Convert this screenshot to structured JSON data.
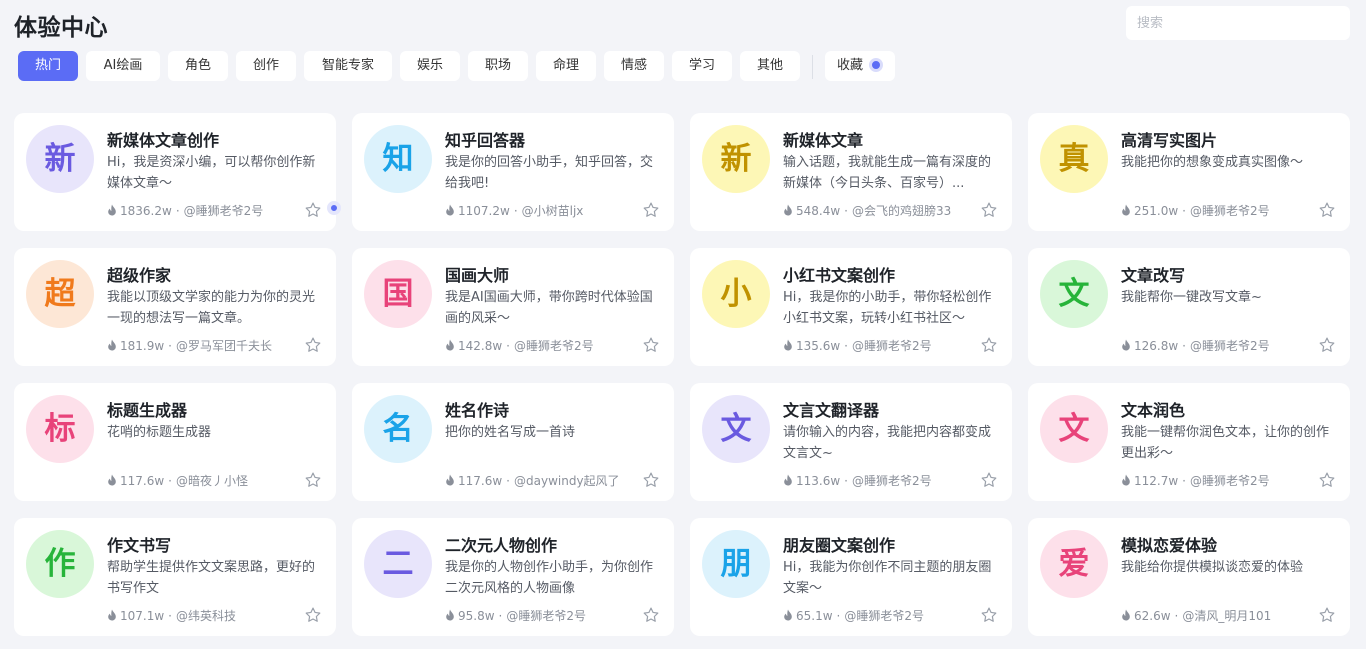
{
  "page": {
    "title": "体验中心"
  },
  "search": {
    "placeholder": "搜索"
  },
  "tabs": [
    "热门",
    "AI绘画",
    "角色",
    "创作",
    "智能专家",
    "娱乐",
    "职场",
    "命理",
    "情感",
    "学习",
    "其他"
  ],
  "favorites_label": "收藏",
  "colors": {
    "accent": "#5b6cf5",
    "page_bg": "#f3f4f8"
  },
  "cards": [
    {
      "avatar": "新",
      "name": "新媒体文章创作",
      "desc": "Hi，我是资深小编，可以帮你创作新媒体文章～",
      "uses": "1836.2w",
      "author": "@睡狮老爷2号",
      "color": "#6a5ae0",
      "bg": "#e8e5fb"
    },
    {
      "avatar": "知",
      "name": "知乎回答器",
      "desc": "我是你的回答小助手，知乎回答，交给我吧!",
      "uses": "1107.2w",
      "author": "@小树苗ljx",
      "color": "#1aa3e8",
      "bg": "#dcf2fc"
    },
    {
      "avatar": "新",
      "name": "新媒体文章",
      "desc": "输入话题，我就能生成一篇有深度的新媒体（今日头条、百家号）...",
      "uses": "548.4w",
      "author": "@会飞的鸡翅膀33",
      "color": "#c09200",
      "bg": "#fdf7b6"
    },
    {
      "avatar": "真",
      "name": "高清写实图片",
      "desc": "我能把你的想象变成真实图像～",
      "uses": "251.0w",
      "author": "@睡狮老爷2号",
      "color": "#c09200",
      "bg": "#fdf7b6"
    },
    {
      "avatar": "超",
      "name": "超级作家",
      "desc": "我能以顶级文学家的能力为你的灵光一现的想法写一篇文章。",
      "uses": "181.9w",
      "author": "@罗马军团千夫长",
      "color": "#f07a1c",
      "bg": "#fde7d6"
    },
    {
      "avatar": "国",
      "name": "国画大师",
      "desc": "我是AI国画大师，带你跨时代体验国画的风采～",
      "uses": "142.8w",
      "author": "@睡狮老爷2号",
      "color": "#e8437a",
      "bg": "#fde0ea"
    },
    {
      "avatar": "小",
      "name": "小红书文案创作",
      "desc": "Hi，我是你的小助手，带你轻松创作小红书文案，玩转小红书社区～",
      "uses": "135.6w",
      "author": "@睡狮老爷2号",
      "color": "#c09200",
      "bg": "#fdf7b6"
    },
    {
      "avatar": "文",
      "name": "文章改写",
      "desc": "我能帮你一键改写文章~",
      "uses": "126.8w",
      "author": "@睡狮老爷2号",
      "color": "#27b43a",
      "bg": "#d9f7d9"
    },
    {
      "avatar": "标",
      "name": "标题生成器",
      "desc": "花哨的标题生成器",
      "uses": "117.6w",
      "author": "@暗夜丿小怪",
      "color": "#e8437a",
      "bg": "#fde0ea"
    },
    {
      "avatar": "名",
      "name": "姓名作诗",
      "desc": "把你的姓名写成一首诗",
      "uses": "117.6w",
      "author": "@daywindy起风了",
      "color": "#1aa3e8",
      "bg": "#dcf2fc"
    },
    {
      "avatar": "文",
      "name": "文言文翻译器",
      "desc": "请你输入的内容，我能把内容都变成文言文~",
      "uses": "113.6w",
      "author": "@睡狮老爷2号",
      "color": "#6a5ae0",
      "bg": "#e8e5fb"
    },
    {
      "avatar": "文",
      "name": "文本润色",
      "desc": "我能一键帮你润色文本，让你的创作更出彩～",
      "uses": "112.7w",
      "author": "@睡狮老爷2号",
      "color": "#e8437a",
      "bg": "#fde0ea"
    },
    {
      "avatar": "作",
      "name": "作文书写",
      "desc": "帮助学生提供作文文案思路，更好的书写作文",
      "uses": "107.1w",
      "author": "@纬英科技",
      "color": "#27b43a",
      "bg": "#d9f7d9"
    },
    {
      "avatar": "二",
      "name": "二次元人物创作",
      "desc": "我是你的人物创作小助手，为你创作二次元风格的人物画像",
      "uses": "95.8w",
      "author": "@睡狮老爷2号",
      "color": "#6a5ae0",
      "bg": "#e8e5fb"
    },
    {
      "avatar": "朋",
      "name": "朋友圈文案创作",
      "desc": "Hi，我能为你创作不同主题的朋友圈文案～",
      "uses": "65.1w",
      "author": "@睡狮老爷2号",
      "color": "#1aa3e8",
      "bg": "#dcf2fc"
    },
    {
      "avatar": "爱",
      "name": "模拟恋爱体验",
      "desc": "我能给你提供模拟谈恋爱的体验",
      "uses": "62.6w",
      "author": "@清风_明月101",
      "color": "#e8437a",
      "bg": "#fde0ea"
    }
  ]
}
